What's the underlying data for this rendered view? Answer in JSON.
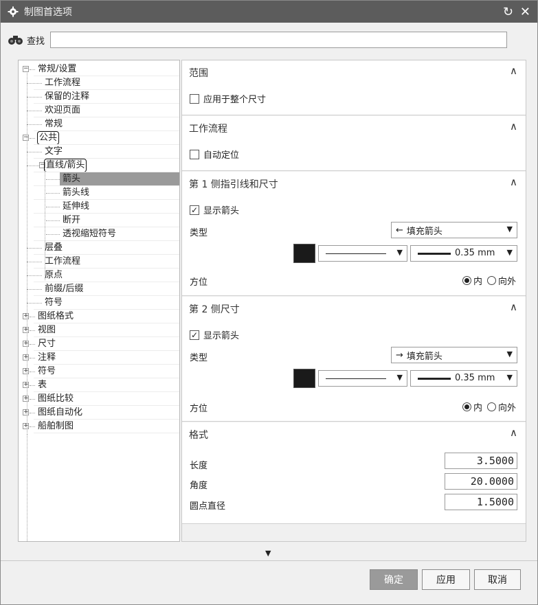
{
  "window": {
    "title": "制图首选项",
    "reset_icon": "↻",
    "close_icon": "✕"
  },
  "find": {
    "label": "查找",
    "value": ""
  },
  "tree": {
    "items": [
      {
        "label": "常规/设置",
        "level": 0,
        "expander": "−"
      },
      {
        "label": "工作流程",
        "level": 1
      },
      {
        "label": "保留的注释",
        "level": 1
      },
      {
        "label": "欢迎页面",
        "level": 1
      },
      {
        "label": "常规",
        "level": 1
      },
      {
        "label": "公共",
        "level": 0,
        "expander": "−",
        "boxed": true
      },
      {
        "label": "文字",
        "level": 1
      },
      {
        "label": "直线/箭头",
        "level": 1,
        "expander": "−",
        "boxed": true
      },
      {
        "label": "箭头",
        "level": 2,
        "selected": true
      },
      {
        "label": "箭头线",
        "level": 2
      },
      {
        "label": "延伸线",
        "level": 2
      },
      {
        "label": "断开",
        "level": 2
      },
      {
        "label": "透视缩短符号",
        "level": 2
      },
      {
        "label": "层叠",
        "level": 1
      },
      {
        "label": "工作流程",
        "level": 1
      },
      {
        "label": "原点",
        "level": 1
      },
      {
        "label": "前缀/后缀",
        "level": 1
      },
      {
        "label": "符号",
        "level": 1
      },
      {
        "label": "图纸格式",
        "level": 0,
        "expander": "+"
      },
      {
        "label": "视图",
        "level": 0,
        "expander": "+"
      },
      {
        "label": "尺寸",
        "level": 0,
        "expander": "+"
      },
      {
        "label": "注释",
        "level": 0,
        "expander": "+"
      },
      {
        "label": "符号",
        "level": 0,
        "expander": "+"
      },
      {
        "label": "表",
        "level": 0,
        "expander": "+"
      },
      {
        "label": "图纸比较",
        "level": 0,
        "expander": "+"
      },
      {
        "label": "图纸自动化",
        "level": 0,
        "expander": "+"
      },
      {
        "label": "船舶制图",
        "level": 0,
        "expander": "+"
      }
    ]
  },
  "sections": {
    "scope": {
      "title": "范围",
      "checkbox_label": "应用于整个尺寸",
      "checked": false
    },
    "workflow": {
      "title": "工作流程",
      "checkbox_label": "自动定位",
      "checked": false
    },
    "side1": {
      "title": "第 1 侧指引线和尺寸",
      "checkbox_label": "显示箭头",
      "checked": true,
      "type_label": "类型",
      "type_value": "填充箭头",
      "type_arrow_glyph": "←",
      "line_width": "0.35 mm",
      "orient_label": "方位",
      "opt_in": "内",
      "opt_out": "向外",
      "selected": "内",
      "color": "#1a1a1a"
    },
    "side2": {
      "title": "第 2 侧尺寸",
      "checkbox_label": "显示箭头",
      "checked": true,
      "type_label": "类型",
      "type_value": "填充箭头",
      "type_arrow_glyph": "→",
      "line_width": "0.35 mm",
      "orient_label": "方位",
      "opt_in": "内",
      "opt_out": "向外",
      "selected": "内",
      "color": "#1a1a1a"
    },
    "format": {
      "title": "格式",
      "length_label": "长度",
      "length_value": "3.5000",
      "angle_label": "角度",
      "angle_value": "20.0000",
      "dot_label": "圆点直径",
      "dot_value": "1.5000"
    }
  },
  "buttons": {
    "ok": "确定",
    "apply": "应用",
    "cancel": "取消"
  },
  "icons": {
    "title": "gear-icon",
    "find": "binoculars-icon",
    "reset": "reset-icon",
    "close": "close-icon",
    "collapse": "chevron-up-icon",
    "dropdown": "triangle-down-icon",
    "more": "more-down-icon"
  }
}
